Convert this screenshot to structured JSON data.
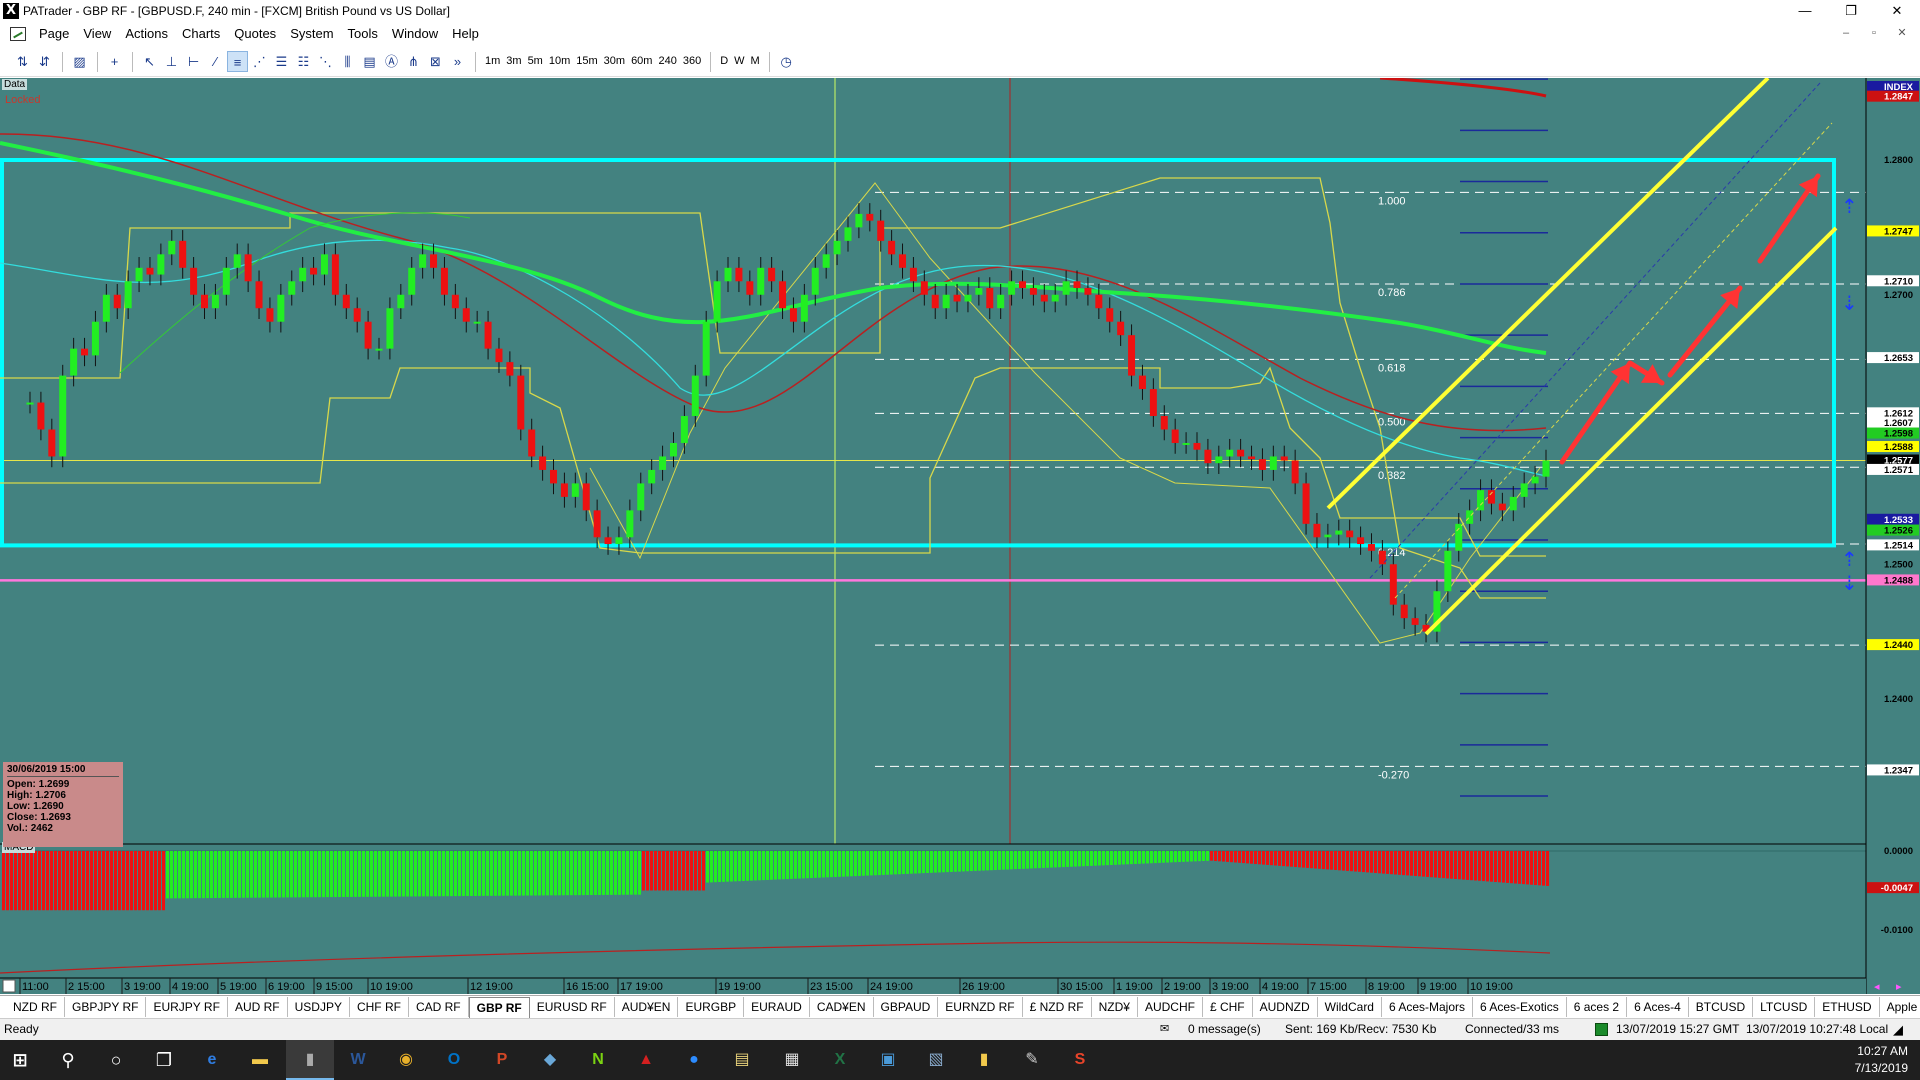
{
  "window": {
    "title": "PATrader - GBP RF - [GBPUSD.F, 240 min - [FXCM] British Pound vs US Dollar]",
    "app_icon": "X",
    "controls": [
      "—",
      "❐",
      "✕"
    ]
  },
  "menu": {
    "items": [
      "Page",
      "View",
      "Actions",
      "Charts",
      "Quotes",
      "System",
      "Tools",
      "Window",
      "Help"
    ],
    "mdi_controls": [
      "–",
      "▫",
      "✕"
    ]
  },
  "toolbar": {
    "timeframes": [
      "1m",
      "3m",
      "5m",
      "10m",
      "15m",
      "30m",
      "60m",
      "240",
      "360"
    ],
    "periods": [
      "D",
      "W",
      "M"
    ],
    "overflow": "»"
  },
  "chart": {
    "data_label": "Data",
    "locked_label": "Locked",
    "macd_label": "MACD",
    "price_labels": [
      {
        "text": "INDEX",
        "price": 1.2868,
        "bg": "#1a1aa0",
        "fg": "#ffffff"
      },
      {
        "text": "1.2847",
        "price": 1.2847,
        "bg": "#cc1111",
        "fg": "#ffffff"
      },
      {
        "text": "1.2800",
        "price": 1.28,
        "bg": "",
        "fg": "#000000"
      },
      {
        "text": "1.2747",
        "price": 1.2747,
        "bg": "#ffff00",
        "fg": "#000000"
      },
      {
        "text": "1.2710",
        "price": 1.271,
        "bg": "#ffffff",
        "fg": "#000000"
      },
      {
        "text": "1.2700",
        "price": 1.27,
        "bg": "",
        "fg": "#000000"
      },
      {
        "text": "1.2653",
        "price": 1.2653,
        "bg": "#ffffff",
        "fg": "#000000"
      },
      {
        "text": "1.2612",
        "price": 1.2612,
        "bg": "#ffffff",
        "fg": "#000000"
      },
      {
        "text": "1.2607",
        "price": 1.2605,
        "bg": "#ffffff",
        "fg": "#000000"
      },
      {
        "text": "1.2598",
        "price": 1.2597,
        "bg": "#22cc22",
        "fg": "#000000"
      },
      {
        "text": "1.2588",
        "price": 1.2587,
        "bg": "#ffff00",
        "fg": "#000000"
      },
      {
        "text": "1.2577",
        "price": 1.2577,
        "bg": "#000000",
        "fg": "#ffffff"
      },
      {
        "text": "1.2571",
        "price": 1.257,
        "bg": "#ffffff",
        "fg": "#000000"
      },
      {
        "text": "1.2533",
        "price": 1.2533,
        "bg": "#1a1aa0",
        "fg": "#ffffff"
      },
      {
        "text": "1.2526",
        "price": 1.2525,
        "bg": "#22cc22",
        "fg": "#000000"
      },
      {
        "text": "1.2514",
        "price": 1.2514,
        "bg": "#ffffff",
        "fg": "#000000"
      },
      {
        "text": "1.2500",
        "price": 1.25,
        "bg": "",
        "fg": "#000000"
      },
      {
        "text": "1.2488",
        "price": 1.2488,
        "bg": "#ff77cc",
        "fg": "#000000"
      },
      {
        "text": "1.2440",
        "price": 1.244,
        "bg": "#ffff00",
        "fg": "#000000"
      },
      {
        "text": "1.2400",
        "price": 1.24,
        "bg": "",
        "fg": "#000000"
      },
      {
        "text": "1.2347",
        "price": 1.2347,
        "bg": "#ffffff",
        "fg": "#000000"
      }
    ],
    "macd_labels": [
      {
        "text": "0.0000",
        "value": 0.0,
        "bg": "",
        "fg": "#000000"
      },
      {
        "text": "-0.0047",
        "value": -0.0047,
        "bg": "#cc1111",
        "fg": "#ffffff"
      },
      {
        "text": "-0.0100",
        "value": -0.01,
        "bg": "",
        "fg": "#000000"
      }
    ],
    "fib_levels": [
      {
        "text": "1.000",
        "price": 1.2776
      },
      {
        "text": "0.786",
        "price": 1.2708
      },
      {
        "text": "0.618",
        "price": 1.2652
      },
      {
        "text": "0.500",
        "price": 1.2612
      },
      {
        "text": "0.382",
        "price": 1.2572
      },
      {
        "text": "0.214",
        "price": 1.2515
      },
      {
        "text": "-0.270",
        "price": 1.235
      }
    ],
    "time_labels": [
      "11:00",
      "2 15:00",
      "3 19:00",
      "4 19:00",
      "5 19:00",
      "6 19:00",
      "9 15:00",
      "10 19:00",
      "12 19:00",
      "16 15:00",
      "17 19:00",
      "19 19:00",
      "23 15:00",
      "24 19:00",
      "26 19:00",
      "30 15:00",
      "1 19:00",
      "2 19:00",
      "3 19:00",
      "4 19:00",
      "7 15:00",
      "8 19:00",
      "9 19:00",
      "10 19:00"
    ],
    "ohlc": {
      "date": "30/06/2019 15:00",
      "open": "Open: 1.2699",
      "high": "High: 1.2706",
      "low": "Low: 1.2690",
      "close": "Close: 1.2693",
      "vol": "Vol.: 2462"
    },
    "colors": {
      "background": "#438280",
      "bull": "#22ee22",
      "bear": "#ee1111",
      "box": "#00ffff",
      "channel": "#ffff33",
      "pink": "#ff77dd",
      "arrows": "#ff3333"
    }
  },
  "tabs": {
    "items": [
      "NZD RF",
      "GBPJPY RF",
      "EURJPY RF",
      "AUD RF",
      "USDJPY",
      "CHF RF",
      "CAD RF",
      "GBP RF",
      "EURUSD RF",
      "AUD¥EN",
      "EURGBP",
      "EURAUD",
      "CAD¥EN",
      "GBPAUD",
      "EURNZD RF",
      "£ NZD RF",
      "NZD¥",
      "AUDCHF",
      "£ CHF",
      "AUDNZD",
      "WildCard",
      "6 Aces-Majors",
      "6 Aces-Exotics",
      "6 aces 2",
      "6 Aces-4",
      "BTCUSD",
      "LTCUSD",
      "ETHUSD",
      "Apple"
    ],
    "active": "GBP RF"
  },
  "status": {
    "ready": "Ready",
    "messages": "0 message(s)",
    "traffic": "Sent: 169 Kb/Recv: 7530 Kb",
    "connection": "Connected/33 ms",
    "gmt_time": "13/07/2019 15:27 GMT",
    "local_time": "13/07/2019 10:27:48 Local"
  },
  "taskbar": {
    "time": "10:27 AM",
    "date": "7/13/2019",
    "apps": [
      {
        "name": "start-icon",
        "glyph": "⊞",
        "color": "#ffffff"
      },
      {
        "name": "search-icon",
        "glyph": "⚲",
        "color": "#ffffff"
      },
      {
        "name": "cortana-icon",
        "glyph": "○",
        "color": "#ffffff"
      },
      {
        "name": "task-view-icon",
        "glyph": "❐",
        "color": "#ffffff"
      },
      {
        "name": "edge-icon",
        "glyph": "e",
        "color": "#2f7de1"
      },
      {
        "name": "file-explorer-icon",
        "glyph": "▬",
        "color": "#f2c94c"
      },
      {
        "name": "patrader-icon",
        "glyph": "▮",
        "color": "#aaaaaa"
      },
      {
        "name": "word-icon",
        "glyph": "W",
        "color": "#2b579a"
      },
      {
        "name": "chrome-icon",
        "glyph": "◉",
        "color": "#e8b02a"
      },
      {
        "name": "outlook-icon",
        "glyph": "O",
        "color": "#0072c6"
      },
      {
        "name": "powerpoint-icon",
        "glyph": "P",
        "color": "#d24726"
      },
      {
        "name": "app-blue-icon",
        "glyph": "◆",
        "color": "#6aa8d8"
      },
      {
        "name": "n-app-icon",
        "glyph": "N",
        "color": "#7bd312"
      },
      {
        "name": "red-app-icon",
        "glyph": "▲",
        "color": "#d42020"
      },
      {
        "name": "zoom-icon",
        "glyph": "●",
        "color": "#2d8cff"
      },
      {
        "name": "folder-app-icon",
        "glyph": "▤",
        "color": "#e8d27a"
      },
      {
        "name": "calculator-icon",
        "glyph": "▦",
        "color": "#dddddd"
      },
      {
        "name": "excel-icon",
        "glyph": "X",
        "color": "#217346"
      },
      {
        "name": "monitor-app-icon",
        "glyph": "▣",
        "color": "#4a9ad8"
      },
      {
        "name": "image-app-icon",
        "glyph": "▧",
        "color": "#88aacc"
      },
      {
        "name": "doc-app-icon",
        "glyph": "▮",
        "color": "#f2c94c"
      },
      {
        "name": "tool-app-icon",
        "glyph": "✎",
        "color": "#cccccc"
      },
      {
        "name": "s-app-icon",
        "glyph": "S",
        "color": "#e8442a"
      }
    ]
  }
}
